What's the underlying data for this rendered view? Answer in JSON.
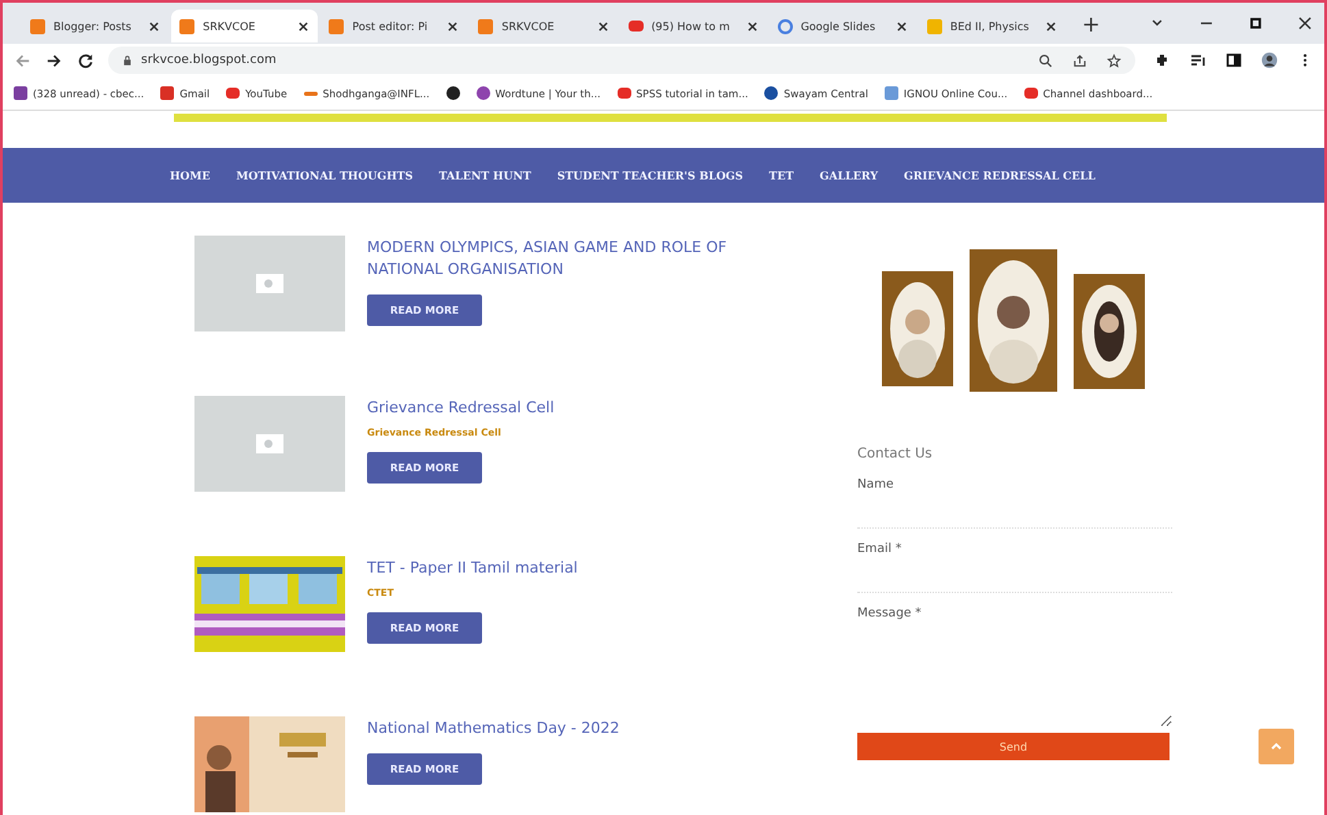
{
  "tabs": [
    {
      "title": "Blogger: Posts",
      "kind": "blogger",
      "selected": false
    },
    {
      "title": "SRKVCOE",
      "kind": "blogger",
      "selected": true
    },
    {
      "title": "Post editor: Pi",
      "kind": "blogger",
      "selected": false
    },
    {
      "title": "SRKVCOE",
      "kind": "blogger",
      "selected": false
    },
    {
      "title": "(95) How to m",
      "kind": "video",
      "selected": false
    },
    {
      "title": "Google Slides",
      "kind": "ring",
      "selected": false
    },
    {
      "title": "BEd II, Physics",
      "kind": "slides",
      "selected": false
    }
  ],
  "new_tab": "+",
  "address": "srkvcoe.blogspot.com",
  "bookmarks": [
    {
      "label": "(328 unread) - cbec...",
      "kind": "square",
      "color": "#7b3fa0"
    },
    {
      "label": "Gmail",
      "kind": "square",
      "color": "#d93025"
    },
    {
      "label": "YouTube",
      "kind": "video",
      "color": "#e52d27"
    },
    {
      "label": "Shodhganga@INFL...",
      "kind": "dash",
      "color": "#e8731a"
    },
    {
      "kind": "round",
      "color": "#222222"
    },
    {
      "label": "Wordtune | Your th...",
      "kind": "round",
      "color": "#8e44ad"
    },
    {
      "label": "SPSS tutorial in tam...",
      "kind": "video",
      "color": "#e52d27"
    },
    {
      "label": "Swayam Central",
      "kind": "round",
      "color": "#1a4fa0"
    },
    {
      "label": "IGNOU Online Cou...",
      "kind": "square",
      "color": "#6a9ad8"
    },
    {
      "label": "Channel dashboard...",
      "kind": "video",
      "color": "#e52d27"
    }
  ],
  "nav": [
    "HOME",
    "MOTIVATIONAL THOUGHTS",
    "TALENT HUNT",
    "STUDENT TEACHER'S BLOGS",
    "TET",
    "GALLERY",
    "GRIEVANCE REDRESSAL CELL"
  ],
  "posts": [
    {
      "title": "MODERN OLYMPICS, ASIAN GAME AND ROLE OF NATIONAL ORGANISATION",
      "kind": "placeholder",
      "button": "READ MORE"
    },
    {
      "title": "Grievance Redressal Cell",
      "label": "Grievance Redressal Cell",
      "kind": "placeholder",
      "button": "READ MORE"
    },
    {
      "title": "TET - Paper II Tamil material",
      "label": "CTET",
      "kind": "banner",
      "button": "READ MORE"
    },
    {
      "title": "National Mathematics Day - 2022",
      "kind": "poster",
      "button": "READ MORE"
    }
  ],
  "contact": {
    "title": "Contact Us",
    "fields": [
      {
        "label": "Name",
        "kind": "input"
      },
      {
        "label": "Email *",
        "kind": "input"
      },
      {
        "label": "Message *",
        "kind": "textarea"
      }
    ],
    "button": "Send"
  }
}
